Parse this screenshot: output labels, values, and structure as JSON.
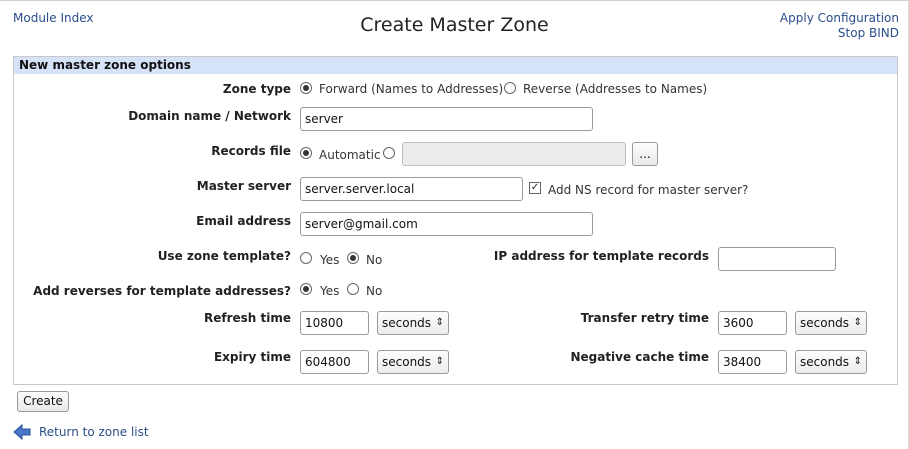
{
  "nav": {
    "module_index": "Module Index",
    "apply_configuration": "Apply Configuration",
    "stop_bind": "Stop BIND",
    "return_link": "Return to zone list"
  },
  "page": {
    "title": "Create Master Zone"
  },
  "panel": {
    "header": "New master zone options"
  },
  "form": {
    "zone_type": {
      "label": "Zone type",
      "options": [
        "Forward (Names to Addresses)",
        "Reverse (Addresses to Names)"
      ],
      "selected": "Forward (Names to Addresses)"
    },
    "domain": {
      "label": "Domain name / Network",
      "value": "server"
    },
    "records_file": {
      "label": "Records file",
      "automatic_label": "Automatic",
      "selected": "Automatic",
      "value": "",
      "browse_label": "..."
    },
    "master_server": {
      "label": "Master server",
      "value": "server.server.local",
      "ns_record_label": "Add NS record for master server?",
      "ns_record_checked": true
    },
    "email": {
      "label": "Email address",
      "value": "server@gmail.com"
    },
    "use_template": {
      "label": "Use zone template?",
      "yes": "Yes",
      "no": "No",
      "selected": "No"
    },
    "ip_template": {
      "label": "IP address for template records",
      "value": ""
    },
    "add_reverses": {
      "label": "Add reverses for template addresses?",
      "yes": "Yes",
      "no": "No",
      "selected": "Yes"
    },
    "refresh": {
      "label": "Refresh time",
      "value": "10800",
      "unit": "seconds"
    },
    "transfer_retry": {
      "label": "Transfer retry time",
      "value": "3600",
      "unit": "seconds"
    },
    "expiry": {
      "label": "Expiry time",
      "value": "604800",
      "unit": "seconds"
    },
    "negative_cache": {
      "label": "Negative cache time",
      "value": "38400",
      "unit": "seconds"
    }
  },
  "buttons": {
    "create": "Create"
  },
  "icons": {
    "return": "left-arrow-icon",
    "dropdown": "up-down-chevron-icon"
  },
  "colors": {
    "header_bg": "#d6e2f7",
    "link": "#2a4e8a",
    "arrow": "#4a78c8"
  }
}
